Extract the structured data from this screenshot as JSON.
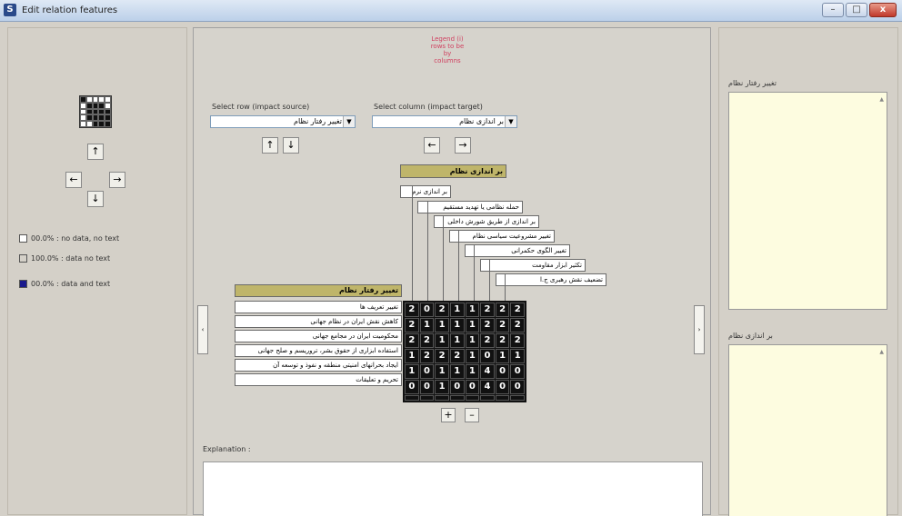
{
  "window": {
    "title": "Edit relation features",
    "minimize": "–",
    "maximize": "□",
    "close": "x"
  },
  "left": {
    "arrows": {
      "up": "↑",
      "left": "←",
      "right": "→",
      "down": "↓"
    },
    "legend": [
      {
        "label": "00.0% : no data, no text",
        "color": "#ffffff"
      },
      {
        "label": "100.0% : data no text",
        "color": "#d4d0c8"
      },
      {
        "label": "00.0% : data and text",
        "color": "#1a1a8c"
      }
    ]
  },
  "center": {
    "pink_lines": [
      "Legend (i)",
      "rows to be",
      "by",
      "columns"
    ],
    "row_select": {
      "label": "Select row (impact source)",
      "value": "تغییر رفتار نظام",
      "up": "↑",
      "down": "↓"
    },
    "col_select": {
      "label": "Select column (impact target)",
      "value": "بر اندازی نظام",
      "left": "←",
      "right": "→"
    },
    "col_header": "بر اندازی نظام",
    "col_labels": [
      "بر اندازی نرم",
      "حمله نظامی یا تهدید مستقیم",
      "بر اندازی از طریق شورش داخلی",
      "تغییر مشروعیت سیاسی نظام",
      "تغییر الگوی حکمرانی",
      "تکثیر ابزار مقاومت",
      "تضعیف نقش رهبری ج.ا"
    ],
    "row_header": "تغییر رفتار نظام",
    "row_labels": [
      "تغییر تعریف ها",
      "کاهش نقش ایران در نظام جهانی",
      "محکومیت ایران در مجامع جهانی",
      "استفاده ابزاری از حقوق بشر، تروریسم و صلح جهانی",
      "ایجاد بحرانهای امنیتی منطقه و نفوذ و توسعه آن",
      "تحریم و تعلیقات"
    ],
    "matrix": [
      [
        "2",
        "0",
        "2",
        "1",
        "1",
        "2",
        "2",
        "2"
      ],
      [
        "2",
        "1",
        "1",
        "1",
        "1",
        "2",
        "2",
        "2"
      ],
      [
        "2",
        "2",
        "1",
        "1",
        "1",
        "2",
        "2",
        "2"
      ],
      [
        "1",
        "2",
        "2",
        "2",
        "1",
        "0",
        "1",
        "1"
      ],
      [
        "1",
        "0",
        "1",
        "1",
        "1",
        "4",
        "0",
        "0"
      ],
      [
        "0",
        "0",
        "1",
        "0",
        "0",
        "4",
        "0",
        "0"
      ],
      [
        "",
        "",
        "",
        "",
        "",
        "",
        "",
        ""
      ]
    ],
    "plus": "+",
    "minus": "–",
    "left_side": "‹",
    "right_side": "›",
    "explanation_label": "Explanation :"
  },
  "right": {
    "top_label": "تغییر رفتار نظام",
    "bottom_label": "بر اندازی نظام"
  }
}
